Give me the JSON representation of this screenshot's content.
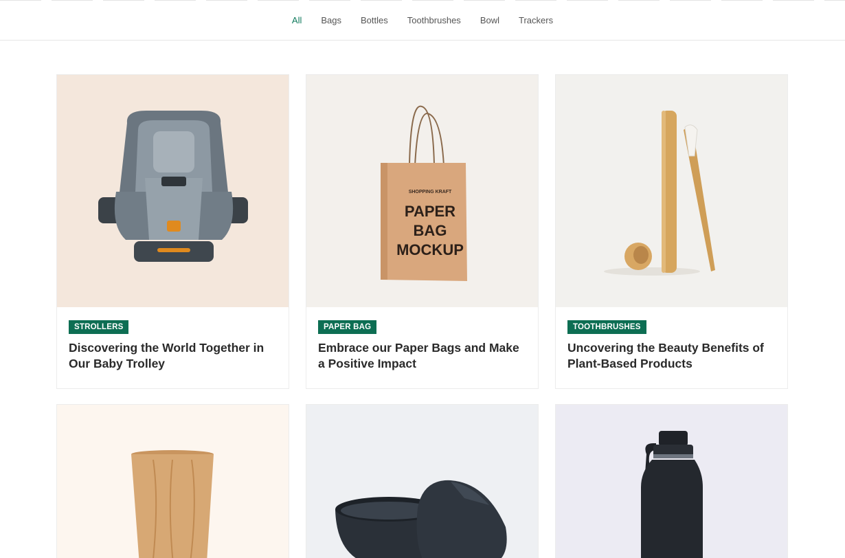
{
  "filters": {
    "tabs": [
      "All",
      "Bags",
      "Bottles",
      "Toothbrushes",
      "Bowl",
      "Trackers"
    ],
    "active": "All"
  },
  "cards": [
    {
      "category": "STROLLERS",
      "title": "Discovering the World Together in Our Baby Trolley",
      "image": "car-seat",
      "bg": "#f4e7dc"
    },
    {
      "category": "PAPER BAG",
      "title": "Embrace our Paper Bags and Make a Positive Impact",
      "image": "paper-bag",
      "bg": "#f3f0ec",
      "image_text": {
        "brand": "SHOPPING KRAFT",
        "line1": "PAPER",
        "line2": "BAG",
        "line3": "MOCKUP"
      }
    },
    {
      "category": "TOOTHBRUSHES",
      "title": "Uncovering the Beauty Benefits of Plant-Based Products",
      "image": "bamboo-toothbrush",
      "bg": "#f2f1ee"
    },
    {
      "category": "",
      "title": "",
      "image": "wooden-cup",
      "bg": "#fdf6ef"
    },
    {
      "category": "",
      "title": "",
      "image": "black-bowls",
      "bg": "#eef0f3"
    },
    {
      "category": "",
      "title": "",
      "image": "water-bottle",
      "bg": "#ecebf3"
    }
  ],
  "colors": {
    "accent": "#0f7a5c",
    "badge": "#0d6e53"
  }
}
